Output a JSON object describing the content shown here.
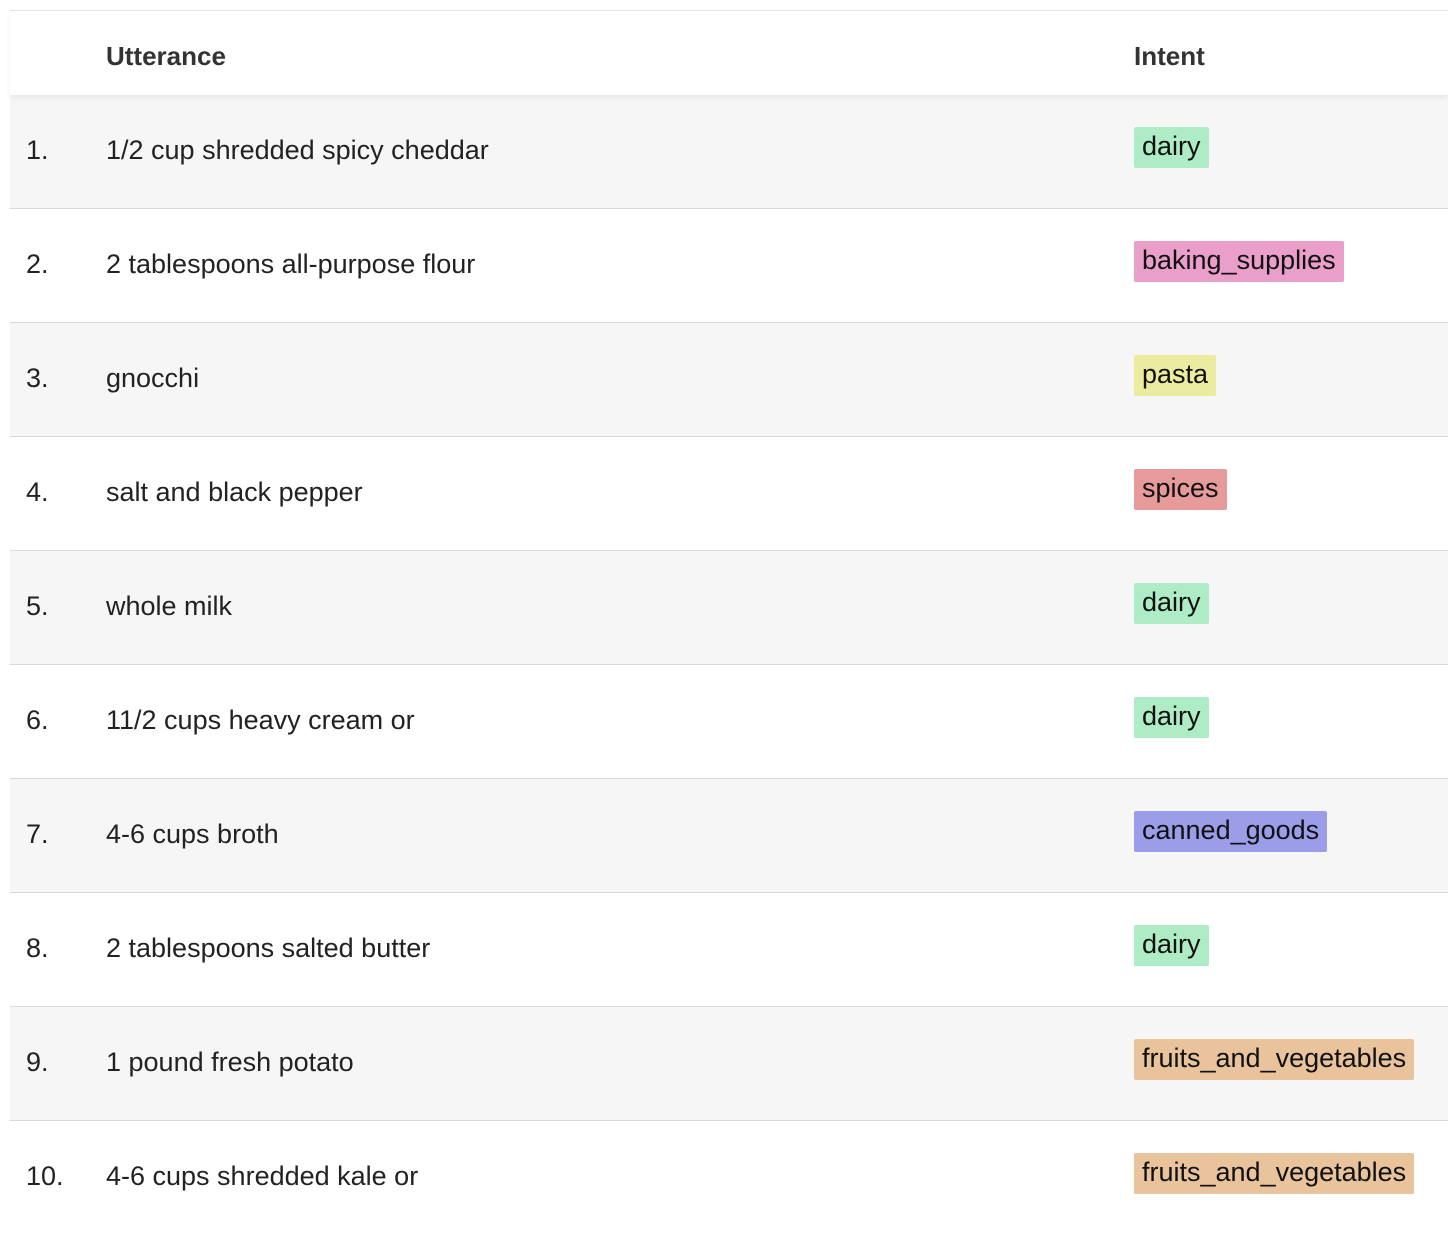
{
  "header": {
    "utterance_label": "Utterance",
    "intent_label": "Intent"
  },
  "intent_colors": {
    "dairy": "#aeecc5",
    "baking_supplies": "#e99fc9",
    "pasta": "#ececa0",
    "spices": "#e79a9a",
    "canned_goods": "#9b9de9",
    "fruits_and_vegetables": "#e8c39c"
  },
  "rows": [
    {
      "num": "1.",
      "utterance": "1/2 cup shredded spicy cheddar",
      "intent": "dairy"
    },
    {
      "num": "2.",
      "utterance": "2 tablespoons all-purpose flour",
      "intent": "baking_supplies"
    },
    {
      "num": "3.",
      "utterance": "gnocchi",
      "intent": "pasta"
    },
    {
      "num": "4.",
      "utterance": "salt and black pepper",
      "intent": "spices"
    },
    {
      "num": "5.",
      "utterance": "whole milk",
      "intent": "dairy"
    },
    {
      "num": "6.",
      "utterance": "11/2 cups heavy cream or",
      "intent": "dairy"
    },
    {
      "num": "7.",
      "utterance": "4-6 cups broth",
      "intent": "canned_goods"
    },
    {
      "num": "8.",
      "utterance": "2 tablespoons salted butter",
      "intent": "dairy"
    },
    {
      "num": "9.",
      "utterance": "1 pound fresh potato",
      "intent": "fruits_and_vegetables"
    },
    {
      "num": "10.",
      "utterance": "4-6 cups shredded kale or",
      "intent": "fruits_and_vegetables"
    }
  ]
}
